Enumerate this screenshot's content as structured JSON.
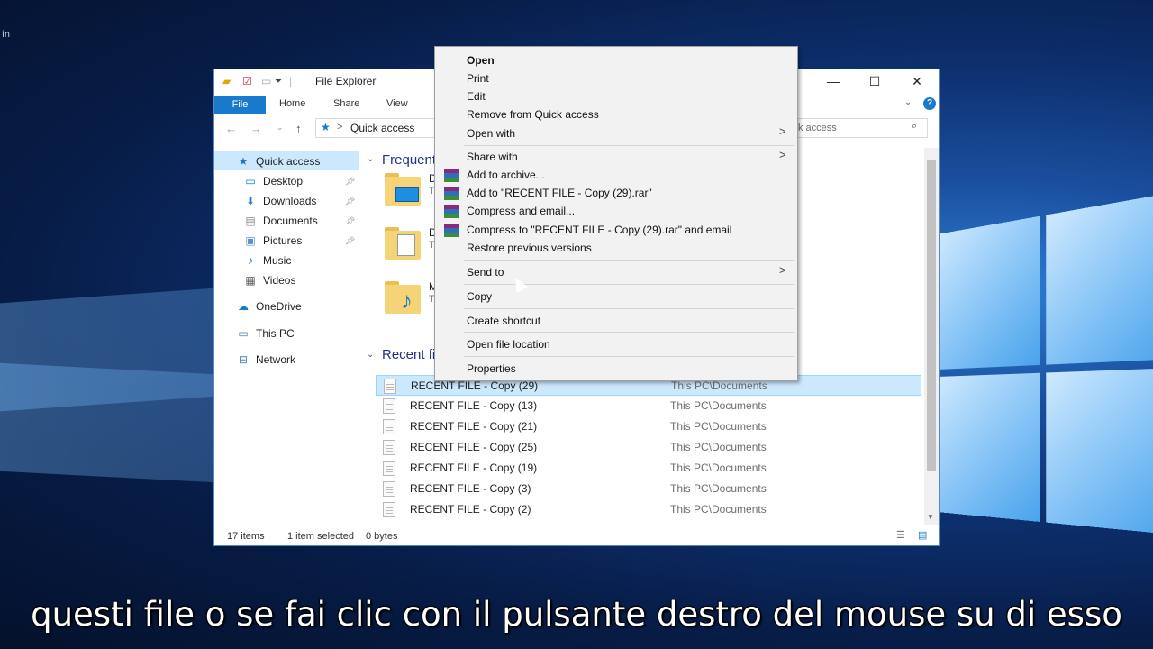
{
  "desktop": {
    "corner_text": "in"
  },
  "window": {
    "title": "File Explorer",
    "controls": {
      "minimize": "—",
      "maximize": "☐",
      "close": "✕"
    },
    "ribbon": {
      "tabs": [
        "File",
        "Home",
        "Share",
        "View"
      ],
      "help": "?"
    },
    "address": {
      "path": "Quick access",
      "separator": ">"
    },
    "search": {
      "text": "ick access"
    },
    "sidebar": {
      "items": [
        {
          "label": "Quick access",
          "icon": "star-icon"
        },
        {
          "label": "Desktop",
          "icon": "desktop-icon",
          "pinned": true
        },
        {
          "label": "Downloads",
          "icon": "download-icon",
          "pinned": true
        },
        {
          "label": "Documents",
          "icon": "documents-icon",
          "pinned": true
        },
        {
          "label": "Pictures",
          "icon": "pictures-icon",
          "pinned": true
        },
        {
          "label": "Music",
          "icon": "music-icon"
        },
        {
          "label": "Videos",
          "icon": "videos-icon"
        },
        {
          "label": "OneDrive",
          "icon": "cloud-icon"
        },
        {
          "label": "This PC",
          "icon": "computer-icon"
        },
        {
          "label": "Network",
          "icon": "network-icon"
        }
      ]
    },
    "content": {
      "frequent_header": "Frequent",
      "recent_header": "Recent fi",
      "frequent_folders": [
        {
          "name": "D",
          "sub": "T"
        },
        {
          "name": "D",
          "sub": "T"
        },
        {
          "name": "M",
          "sub": "T"
        }
      ],
      "recent_files": [
        {
          "name": "RECENT FILE - Copy (29)",
          "location": "This PC\\Documents",
          "selected": true
        },
        {
          "name": "RECENT FILE - Copy (13)",
          "location": "This PC\\Documents"
        },
        {
          "name": "RECENT FILE - Copy (21)",
          "location": "This PC\\Documents"
        },
        {
          "name": "RECENT FILE - Copy (25)",
          "location": "This PC\\Documents"
        },
        {
          "name": "RECENT FILE - Copy (19)",
          "location": "This PC\\Documents"
        },
        {
          "name": "RECENT FILE - Copy (3)",
          "location": "This PC\\Documents"
        },
        {
          "name": "RECENT FILE - Copy (2)",
          "location": "This PC\\Documents"
        }
      ]
    },
    "status": {
      "items": "17 items",
      "selected": "1 item selected",
      "size": "0 bytes"
    }
  },
  "context_menu": {
    "items": [
      {
        "label": "Open",
        "bold": true
      },
      {
        "label": "Print"
      },
      {
        "label": "Edit"
      },
      {
        "label": "Remove from Quick access"
      },
      {
        "label": "Open with",
        "submenu": true
      },
      {
        "label": "Share with",
        "submenu": true
      },
      {
        "label": "Add to archive...",
        "icon": "winrar-icon"
      },
      {
        "label": "Add to \"RECENT FILE - Copy (29).rar\"",
        "icon": "winrar-icon"
      },
      {
        "label": "Compress and email...",
        "icon": "winrar-icon"
      },
      {
        "label": "Compress to \"RECENT FILE - Copy (29).rar\" and email",
        "icon": "winrar-icon"
      },
      {
        "label": "Restore previous versions"
      },
      {
        "label": "Send to",
        "submenu": true
      },
      {
        "label": "Copy"
      },
      {
        "label": "Create shortcut"
      },
      {
        "label": "Open file location"
      },
      {
        "label": "Properties"
      }
    ]
  },
  "subtitle": "questi file o se fai clic con il pulsante destro del mouse su di esso",
  "colors": {
    "accent": "#1979ca",
    "selection": "#cce8ff",
    "folder": "#f5d477"
  }
}
